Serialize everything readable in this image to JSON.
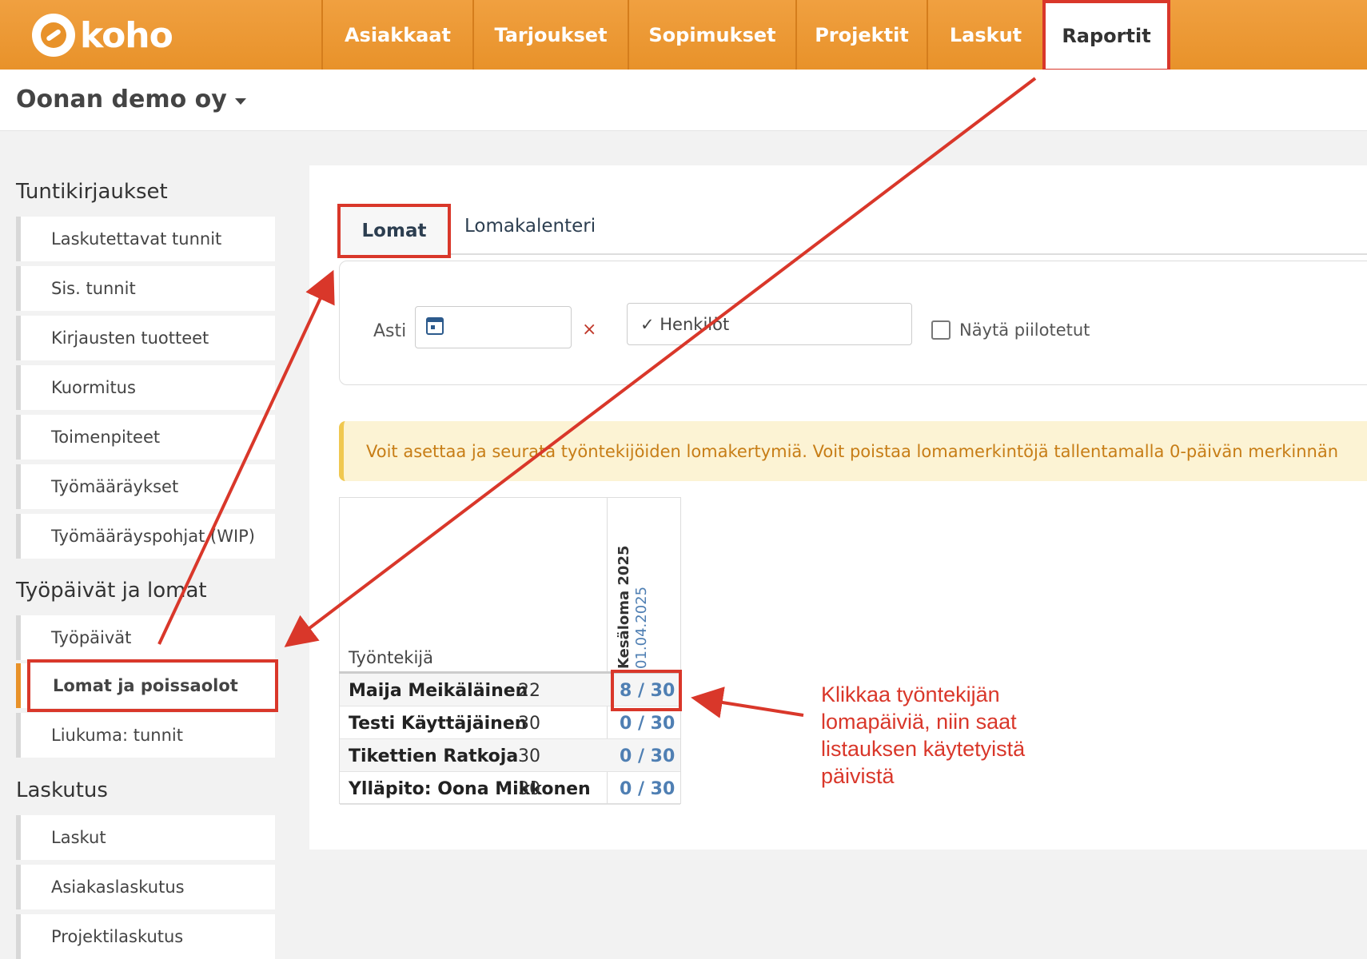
{
  "logo": {
    "text": "koho"
  },
  "nav": {
    "items": [
      "Asiakkaat",
      "Tarjoukset",
      "Sopimukset",
      "Projektit",
      "Laskut",
      "Raportit"
    ],
    "active": "Raportit"
  },
  "company": {
    "name": "Oonan demo oy"
  },
  "sidebar": {
    "section1": {
      "title": "Tuntikirjaukset",
      "items": [
        "Laskutettavat tunnit",
        "Sis. tunnit",
        "Kirjausten tuotteet",
        "Kuormitus",
        "Toimenpiteet",
        "Työmääräykset",
        "Työmääräyspohjat (WIP)"
      ]
    },
    "section2": {
      "title": "Työpäivät ja lomat",
      "items": [
        "Työpäivät",
        "Lomat ja poissaolot",
        "Liukuma: tunnit"
      ]
    },
    "section3": {
      "title": "Laskutus",
      "items": [
        "Laskut",
        "Asiakaslaskutus",
        "Projektilaskutus"
      ]
    }
  },
  "tabs": [
    "Lomat",
    "Lomakalenteri"
  ],
  "filters": {
    "asti_label": "Asti",
    "clear": "×",
    "persons": "✓ Henkilöt",
    "show_hidden": "Näytä piilotetut"
  },
  "alert": "Voit asettaa ja seurata työntekijöiden lomakertymiä. Voit poistaa lomamerkintöjä tallentamalla 0-päivän merkinnän",
  "table": {
    "name_header": "Työntekijä",
    "col_title": "Kesäloma 2025",
    "col_date": "01.04.2025",
    "rows": [
      {
        "name": "Maija Meikäläinen",
        "num": "22",
        "value": "8 / 30"
      },
      {
        "name": "Testi Käyttäjäinen",
        "num": "30",
        "value": "0 / 30"
      },
      {
        "name": "Tikettien Ratkoja",
        "num": "30",
        "value": "0 / 30"
      },
      {
        "name": "Ylläpito: Oona Mikkonen",
        "num": "30",
        "value": "0 / 30"
      }
    ]
  },
  "annotation": {
    "lines": [
      "Klikkaa työntekijän",
      "lomapäiviä, niin saat",
      "listauksen käytetyistä",
      "päivistä"
    ],
    "color": "#d9372a"
  },
  "colors": {
    "brand": "#e8922a",
    "highlight": "#d9372a",
    "link": "#4f7fb3"
  }
}
